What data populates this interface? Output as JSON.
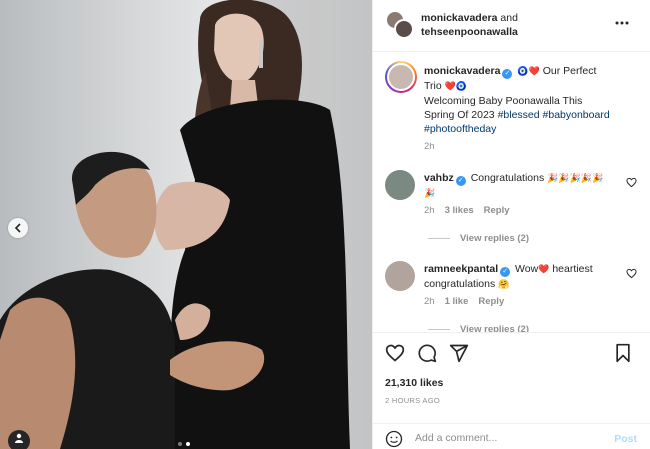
{
  "header": {
    "user1": "monickavadera",
    "conjunction": "and",
    "user2": "tehseenpoonawalla"
  },
  "caption": {
    "username": "monickavadera",
    "emoji_after_name": "🧿❤️",
    "text_line1": "Our Perfect Trio",
    "emoji_line1": "❤️🧿",
    "text_line2": "Welcoming Baby Poonawalla This Spring Of 2023",
    "hashtag1": "#blessed",
    "hashtag2": "#babyonboard",
    "hashtag3": "#photooftheday",
    "time": "2h"
  },
  "comments": [
    {
      "username": "vahbz",
      "text": "Congratulations",
      "emoji": "🎉🎉🎉🎉🎉🎉",
      "time": "2h",
      "likes": "3 likes",
      "reply": "Reply",
      "view_replies": "View replies (2)"
    },
    {
      "username": "ramneekpantal",
      "text_before": "Wow",
      "emoji_mid": "❤️",
      "text_after": "heartiest congratulations",
      "emoji_end": "🤗",
      "time": "2h",
      "likes": "1 like",
      "reply": "Reply",
      "view_replies": "View replies (2)"
    }
  ],
  "stats": {
    "likes": "21,310 likes",
    "time_ago": "2 HOURS AGO"
  },
  "comment_box": {
    "placeholder": "Add a comment...",
    "post_label": "Post"
  },
  "icons": {
    "header_more": "more-horizontal-icon",
    "like": "heart-icon",
    "comment": "comment-icon",
    "share": "share-icon",
    "save": "bookmark-icon",
    "emoji": "smiley-icon",
    "tag": "user-tag-icon",
    "prev": "chevron-left-icon"
  },
  "colors": {
    "hashtag": "#00376b",
    "verified": "#3897f0",
    "post_button": "#b3dbff",
    "meta": "#8e8e8e"
  }
}
